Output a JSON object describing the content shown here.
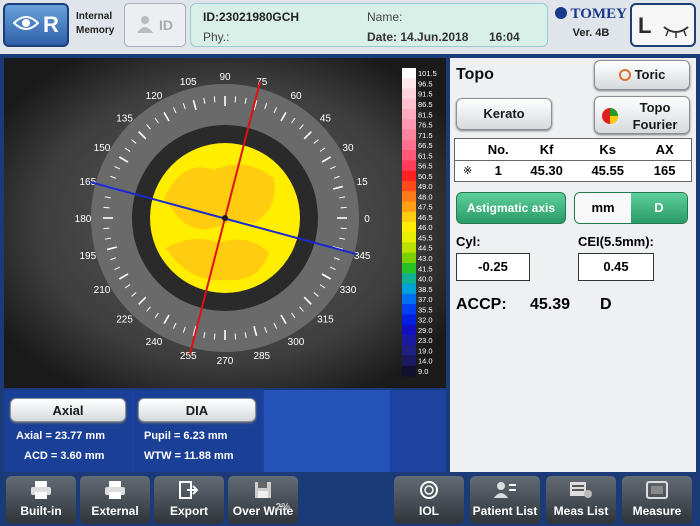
{
  "header": {
    "eye_right": "R",
    "internal_memory_line1": "Internal",
    "internal_memory_line2": "Memory",
    "id_button": "ID",
    "patient_id": "ID:23021980GCH",
    "name_label": "Name:",
    "phy_label": "Phy.:",
    "date": "Date: 14.Jun.2018",
    "time": "16:04",
    "brand": "TOMEY",
    "version": "Ver. 4B",
    "eye_left": "L"
  },
  "map": {
    "axis_labels": [
      "90",
      "75",
      "60",
      "45",
      "30",
      "15",
      "0",
      "345",
      "330",
      "315",
      "300",
      "285",
      "270",
      "255",
      "240",
      "225",
      "210",
      "195",
      "180",
      "165",
      "150",
      "135",
      "120",
      "105"
    ],
    "scale": [
      "101.5",
      "96.5",
      "91.5",
      "86.5",
      "81.5",
      "76.5",
      "71.5",
      "66.5",
      "61.5",
      "56.5",
      "50.5",
      "49.0",
      "48.0",
      "47.5",
      "46.5",
      "46.0",
      "45.5",
      "44.5",
      "43.0",
      "41.5",
      "40.0",
      "38.5",
      "37.0",
      "35.5",
      "32.0",
      "29.0",
      "23.0",
      "19.0",
      "14.0",
      "9.0"
    ],
    "scale_colors": [
      "#ffffff",
      "#ffe8ee",
      "#ffd4de",
      "#ffc0cf",
      "#ffacbf",
      "#ff98b0",
      "#ff84a0",
      "#ff7090",
      "#ff5878",
      "#ff3c5a",
      "#ff2020",
      "#ff4a1c",
      "#ff7a18",
      "#ffa014",
      "#ffcc10",
      "#ffee00",
      "#e8f000",
      "#b8e000",
      "#7cd000",
      "#28c028",
      "#10b090",
      "#00a0d8",
      "#0070f0",
      "#0040f0",
      "#0020e0",
      "#1010c0",
      "#1a1aa0",
      "#202080",
      "#1a1a60",
      "#101030"
    ],
    "flat_axis_color": "#1a2ad0",
    "steep_axis_color": "#e01010"
  },
  "right": {
    "title": "Topo",
    "toric_button": "Toric",
    "kerato_button": "Kerato",
    "topo_fourier_line1": "Topo",
    "topo_fourier_line2": "Fourier",
    "table_headers": [
      "No.",
      "Kf",
      "Ks",
      "AX"
    ],
    "table_row": [
      "※",
      "1",
      "45.30",
      "45.55",
      "165"
    ],
    "astig_button": "Astigmatic axis",
    "mm_button": "mm",
    "d_button": "D",
    "cyl_label": "Cyl:",
    "cyl_value": "-0.25",
    "cei_label": "CEI(5.5mm):",
    "cei_value": "0.45",
    "accp_label": "ACCP:",
    "accp_value": "45.39",
    "accp_unit": "D"
  },
  "info": {
    "axial_button": "Axial",
    "axial_value": "Axial = 23.77 mm",
    "acd_value": "ACD = 3.60 mm",
    "dia_button": "DIA",
    "pupil_value": "Pupil = 6.23 mm",
    "wtw_value": "WTW = 11.88 mm"
  },
  "footer": {
    "builtin": "Built-in",
    "external": "External",
    "export": "Export",
    "overwrite": "Over Write",
    "overwrite_pct": "2%",
    "iol": "IOL",
    "patient_list": "Patient List",
    "meas_list": "Meas List",
    "measure": "Measure"
  }
}
